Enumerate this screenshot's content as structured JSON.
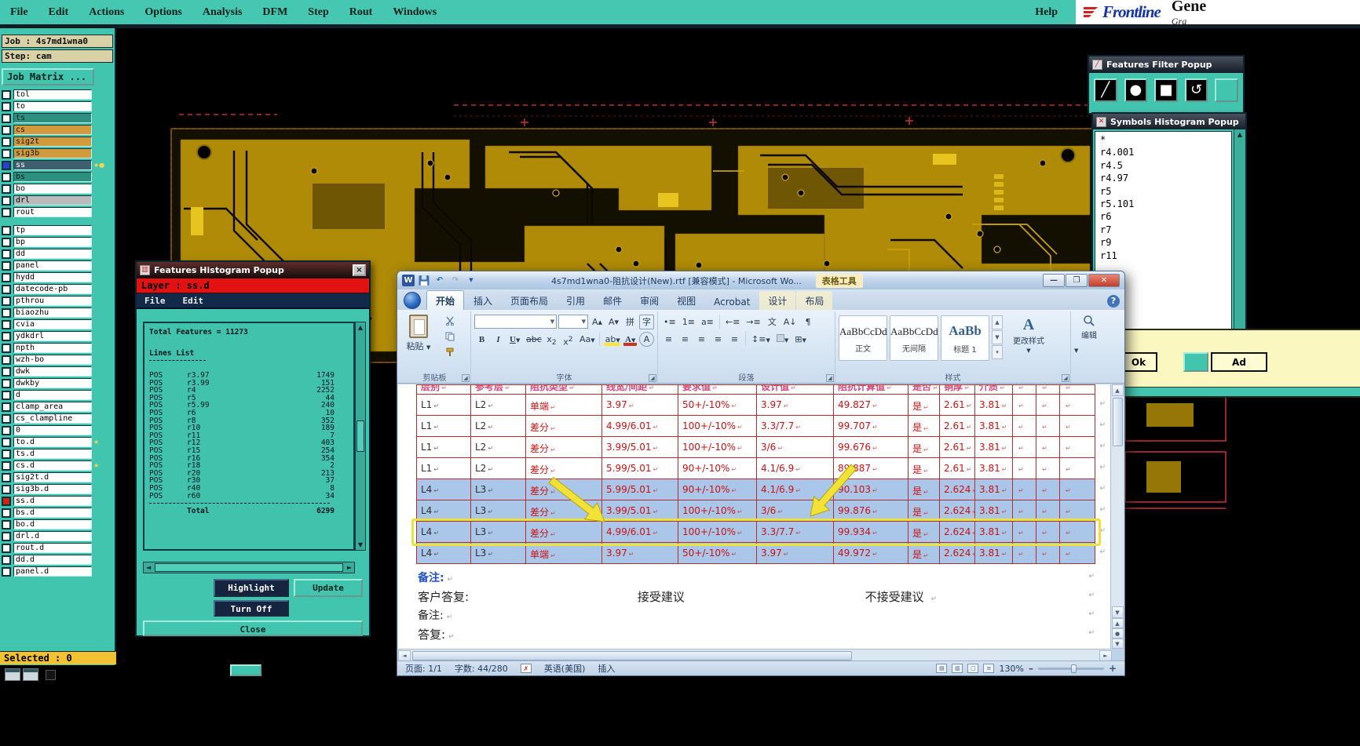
{
  "app": {
    "menu": [
      "File",
      "Edit",
      "Actions",
      "Options",
      "Analysis",
      "DFM",
      "Step",
      "Rout",
      "Windows"
    ],
    "help": "Help",
    "brand": {
      "name": "Frontline",
      "suffix": "Gene",
      "tagline": "Gra"
    }
  },
  "sidebar": {
    "job": "Job : 4s7md1wna0",
    "step": "Step: cam",
    "job_matrix": "Job Matrix ...",
    "selected": "Selected : 0",
    "layers": [
      {
        "name": "tol",
        "bg": "#ffffff",
        "fg": "#000000",
        "check": "#ffffff"
      },
      {
        "name": "to",
        "bg": "#ffffff",
        "fg": "#000000",
        "check": "#ffffff"
      },
      {
        "name": "ts",
        "bg": "#2e8f7e",
        "fg": "#00221c",
        "check": "#ffffff"
      },
      {
        "name": "cs",
        "bg": "#d29a3c",
        "fg": "#1a1000",
        "check": "#ffffff"
      },
      {
        "name": "sig2t",
        "bg": "#d29a3c",
        "fg": "#1a1000",
        "check": "#ffffff"
      },
      {
        "name": "sig3b",
        "bg": "#d29a3c",
        "fg": "#1a1000",
        "check": "#ffffff"
      },
      {
        "name": "ss",
        "bg": "#3d5f6e",
        "fg": "#ffffff",
        "check": "#2b3fd0",
        "marker": "★●"
      },
      {
        "name": "bs",
        "bg": "#2e8f7e",
        "fg": "#00221c",
        "check": "#ffffff"
      },
      {
        "name": "bo",
        "bg": "#ffffff",
        "fg": "#000000",
        "check": "#ffffff"
      },
      {
        "name": "drl",
        "bg": "#b9bcba",
        "fg": "#000000",
        "check": "#ffffff"
      },
      {
        "name": "rout",
        "bg": "#ffffff",
        "fg": "#000000",
        "check": "#ffffff"
      },
      {
        "name": "tp",
        "bg": "#ffffff",
        "fg": "#000000",
        "check": "#ffffff",
        "gap": true
      },
      {
        "name": "bp",
        "bg": "#ffffff",
        "fg": "#000000",
        "check": "#ffffff"
      },
      {
        "name": "dd",
        "bg": "#ffffff",
        "fg": "#000000",
        "check": "#ffffff"
      },
      {
        "name": "panel",
        "bg": "#ffffff",
        "fg": "#000000",
        "check": "#ffffff"
      },
      {
        "name": "hydd",
        "bg": "#ffffff",
        "fg": "#000000",
        "check": "#ffffff"
      },
      {
        "name": "datecode-pb",
        "bg": "#ffffff",
        "fg": "#000000",
        "check": "#ffffff"
      },
      {
        "name": "pthrou",
        "bg": "#ffffff",
        "fg": "#000000",
        "check": "#ffffff"
      },
      {
        "name": "biaozhu",
        "bg": "#ffffff",
        "fg": "#000000",
        "check": "#ffffff"
      },
      {
        "name": "cvia",
        "bg": "#ffffff",
        "fg": "#000000",
        "check": "#ffffff"
      },
      {
        "name": "ydkdrl",
        "bg": "#ffffff",
        "fg": "#000000",
        "check": "#ffffff"
      },
      {
        "name": "npth",
        "bg": "#ffffff",
        "fg": "#000000",
        "check": "#ffffff"
      },
      {
        "name": "wzh-bo",
        "bg": "#ffffff",
        "fg": "#000000",
        "check": "#ffffff"
      },
      {
        "name": "dwk",
        "bg": "#ffffff",
        "fg": "#000000",
        "check": "#ffffff"
      },
      {
        "name": "dwkby",
        "bg": "#ffffff",
        "fg": "#000000",
        "check": "#ffffff"
      },
      {
        "name": "d",
        "bg": "#ffffff",
        "fg": "#000000",
        "check": "#ffffff"
      },
      {
        "name": "clamp_area",
        "bg": "#ffffff",
        "fg": "#000000",
        "check": "#ffffff"
      },
      {
        "name": "cs_clampline",
        "bg": "#ffffff",
        "fg": "#000000",
        "check": "#ffffff"
      },
      {
        "name": "0",
        "bg": "#ffffff",
        "fg": "#000000",
        "check": "#ffffff"
      },
      {
        "name": "to.d",
        "bg": "#ffffff",
        "fg": "#000000",
        "check": "#ffffff",
        "marker": "★"
      },
      {
        "name": "ts.d",
        "bg": "#ffffff",
        "fg": "#000000",
        "check": "#ffffff"
      },
      {
        "name": "cs.d",
        "bg": "#ffffff",
        "fg": "#000000",
        "check": "#ffffff",
        "marker": "★"
      },
      {
        "name": "sig2t.d",
        "bg": "#ffffff",
        "fg": "#000000",
        "check": "#ffffff"
      },
      {
        "name": "sig3b.d",
        "bg": "#ffffff",
        "fg": "#000000",
        "check": "#ffffff"
      },
      {
        "name": "ss.d",
        "bg": "#ffffff",
        "fg": "#000000",
        "check": "#d42310"
      },
      {
        "name": "bs.d",
        "bg": "#ffffff",
        "fg": "#000000",
        "check": "#ffffff"
      },
      {
        "name": "bo.d",
        "bg": "#ffffff",
        "fg": "#000000",
        "check": "#ffffff"
      },
      {
        "name": "drl.d",
        "bg": "#ffffff",
        "fg": "#000000",
        "check": "#ffffff"
      },
      {
        "name": "rout.d",
        "bg": "#ffffff",
        "fg": "#000000",
        "check": "#ffffff"
      },
      {
        "name": "dd.d",
        "bg": "#ffffff",
        "fg": "#000000",
        "check": "#ffffff"
      },
      {
        "name": "panel.d",
        "bg": "#ffffff",
        "fg": "#000000",
        "check": "#ffffff"
      }
    ]
  },
  "histogram": {
    "title": "Features Histogram Popup",
    "layer_banner": "Layer :  ss.d",
    "menu": [
      "File",
      "Edit"
    ],
    "total_line": "Total Features = 11273",
    "list_title": "Lines List",
    "rows": [
      {
        "t": "POS",
        "n": "r3.97",
        "c": "1749"
      },
      {
        "t": "POS",
        "n": "r3.99",
        "c": "151"
      },
      {
        "t": "POS",
        "n": "r4",
        "c": "2252"
      },
      {
        "t": "POS",
        "n": "r5",
        "c": "44"
      },
      {
        "t": "POS",
        "n": "r5.99",
        "c": "240"
      },
      {
        "t": "POS",
        "n": "r6",
        "c": "10"
      },
      {
        "t": "POS",
        "n": "r8",
        "c": "352"
      },
      {
        "t": "POS",
        "n": "r10",
        "c": "189"
      },
      {
        "t": "POS",
        "n": "r11",
        "c": "7"
      },
      {
        "t": "POS",
        "n": "r12",
        "c": "403"
      },
      {
        "t": "POS",
        "n": "r15",
        "c": "254"
      },
      {
        "t": "POS",
        "n": "r16",
        "c": "354"
      },
      {
        "t": "POS",
        "n": "r18",
        "c": "2"
      },
      {
        "t": "POS",
        "n": "r20",
        "c": "213"
      },
      {
        "t": "POS",
        "n": "r30",
        "c": "37"
      },
      {
        "t": "POS",
        "n": "r40",
        "c": "8"
      },
      {
        "t": "POS",
        "n": "r60",
        "c": "34"
      }
    ],
    "total_label": "Total",
    "total_value": "6299",
    "buttons": {
      "highlight": "Highlight",
      "update": "Update",
      "turn_off": "Turn Off",
      "close": "Close"
    }
  },
  "word": {
    "title": "4s7md1wna0-阻抗设计(New).rtf [兼容模式] - Microsoft Wo...",
    "context_title": "表格工具",
    "tabs": [
      {
        "label": "开始",
        "active": true
      },
      {
        "label": "插入"
      },
      {
        "label": "页面布局"
      },
      {
        "label": "引用"
      },
      {
        "label": "邮件"
      },
      {
        "label": "审阅"
      },
      {
        "label": "视图"
      },
      {
        "label": "Acrobat"
      },
      {
        "label": "设计",
        "contextual": true
      },
      {
        "label": "布局",
        "contextual": true
      }
    ],
    "ribbon": {
      "paste": "粘贴",
      "groups": [
        "剪贴板",
        "字体",
        "段落",
        "样式"
      ],
      "font_name": "",
      "font_size": "",
      "icons": {
        "bold": "B",
        "italic": "I",
        "underline": "U",
        "strikethrough": "abc",
        "subscript": "x",
        "superscript": "x",
        "change_case": "Aa",
        "highlight": "ab",
        "font_color": "A",
        "phonetic": "拼",
        "char_border": "字",
        "grow_font": "A▴",
        "shrink_font": "A▾",
        "bullets": "•≡",
        "numbering": "1≡",
        "multilevel": "a≡",
        "outdent": "←≡",
        "indent": "→≡",
        "asian": "文",
        "sort": "A↓",
        "marks": "¶",
        "align1": "≡",
        "align2": "≡",
        "align3": "≡",
        "align4": "≡",
        "align5": "≡",
        "spacing": "↕≡",
        "borders": "⊞"
      },
      "styles": [
        {
          "preview": "AaBbCcDd",
          "name": "正文"
        },
        {
          "preview": "AaBbCcDd",
          "name": "无间隔"
        },
        {
          "preview": "AaBb",
          "name": "标题 1",
          "big": true
        }
      ],
      "change_styles": "更改样式",
      "editing": "编辑"
    },
    "table": {
      "header": [
        "层别",
        "参考层",
        "阻抗类型",
        "线宽/间距",
        "要求值",
        "设计值",
        "阻抗计算值",
        "是否",
        "铜厚",
        "介质",
        "",
        "",
        ""
      ],
      "rows": [
        {
          "cells": [
            "L1",
            "L2",
            "单端",
            "3.97",
            "50+/-10%",
            "3.97",
            "49.827",
            "是",
            "2.61",
            "3.81",
            "",
            "",
            ""
          ],
          "selected": false
        },
        {
          "cells": [
            "L1",
            "L2",
            "差分",
            "4.99/6.01",
            "100+/-10%",
            "3.3/7.7",
            "99.707",
            "是",
            "2.61",
            "3.81",
            "",
            "",
            ""
          ],
          "selected": false
        },
        {
          "cells": [
            "L1",
            "L2",
            "差分",
            "3.99/5.01",
            "100+/-10%",
            "3/6",
            "99.676",
            "是",
            "2.61",
            "3.81",
            "",
            "",
            ""
          ],
          "selected": false
        },
        {
          "cells": [
            "L1",
            "L2",
            "差分",
            "5.99/5.01",
            "90+/-10%",
            "4.1/6.9",
            "89.887",
            "是",
            "2.61",
            "3.81",
            "",
            "",
            ""
          ],
          "selected": false
        },
        {
          "cells": [
            "L4",
            "L3",
            "差分",
            "5.99/5.01",
            "90+/-10%",
            "4.1/6.9",
            "90.103",
            "是",
            "2.624",
            "3.81",
            "",
            "",
            ""
          ],
          "selected": true
        },
        {
          "cells": [
            "L4",
            "L3",
            "差分",
            "3.99/5.01",
            "100+/-10%",
            "3/6",
            "99.876",
            "是",
            "2.624",
            "3.81",
            "",
            "",
            ""
          ],
          "selected": true
        },
        {
          "cells": [
            "L4",
            "L3",
            "差分",
            "4.99/6.01",
            "100+/-10%",
            "3.3/7.7",
            "99.934",
            "是",
            "2.624",
            "3.81",
            "",
            "",
            ""
          ],
          "selected": true,
          "highlighted": true
        },
        {
          "cells": [
            "L4",
            "L3",
            "单端",
            "3.97",
            "50+/-10%",
            "3.97",
            "49.972",
            "是",
            "2.624",
            "3.81",
            "",
            "",
            ""
          ],
          "selected": true
        }
      ]
    },
    "notes": {
      "note1": "备注:",
      "reply_label": "客户答复:",
      "accept": "接受建议",
      "reject": "不接受建议",
      "note2": "备注:",
      "reply2": "答复:"
    },
    "status": {
      "page": "页面: 1/1",
      "words": "字数: 44/280",
      "lang": "英语(美国)",
      "mode": "插入",
      "zoom": "130%"
    }
  },
  "filter_popup": {
    "title": "Features Filter Popup"
  },
  "symbols_popup": {
    "title": "Symbols Histogram Popup",
    "items": [
      "*",
      "r4.001",
      "r4.5",
      "r4.97",
      "r5",
      "r5.101",
      "r6",
      "r7",
      "r9",
      "r11"
    ]
  },
  "right_panel": {
    "ok": "Ok",
    "add": "Ad"
  }
}
